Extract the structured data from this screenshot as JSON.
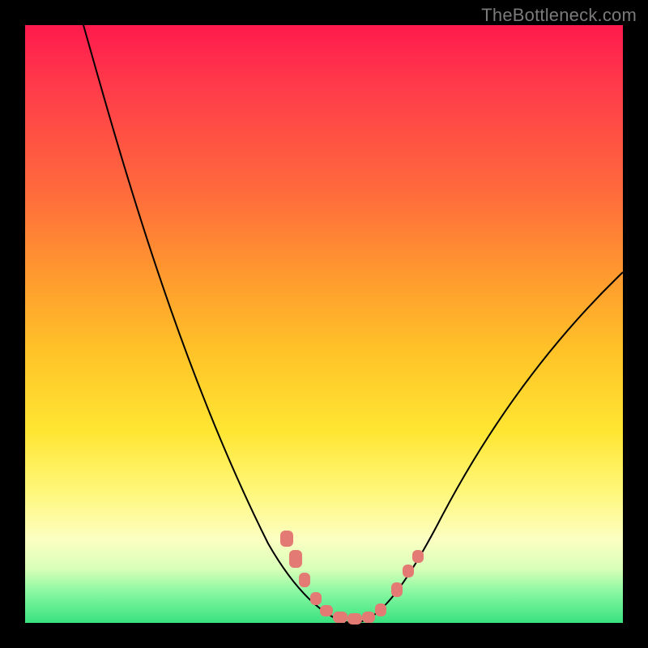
{
  "watermark": "TheBottleneck.com",
  "chart_data": {
    "type": "line",
    "title": "",
    "xlabel": "",
    "ylabel": "",
    "xlim": [
      0,
      100
    ],
    "ylim": [
      0,
      100
    ],
    "series": [
      {
        "name": "bottleneck-curve",
        "x": [
          10,
          15,
          20,
          25,
          30,
          35,
          40,
          45,
          50,
          53,
          55,
          58,
          60,
          65,
          70,
          75,
          80,
          85,
          90,
          95,
          100
        ],
        "y": [
          100,
          86,
          72,
          59,
          46,
          34,
          23,
          13,
          5,
          1,
          0,
          1,
          3,
          9,
          17,
          25,
          33,
          41,
          48,
          54,
          59
        ]
      }
    ],
    "markers": {
      "name": "highlight-beads",
      "shape": "rounded-square",
      "color": "#e37b74",
      "points": [
        {
          "x": 44,
          "y": 14
        },
        {
          "x": 45.5,
          "y": 11
        },
        {
          "x": 48,
          "y": 6
        },
        {
          "x": 50,
          "y": 3
        },
        {
          "x": 52,
          "y": 1
        },
        {
          "x": 54,
          "y": 0
        },
        {
          "x": 56,
          "y": 0
        },
        {
          "x": 58,
          "y": 1
        },
        {
          "x": 60,
          "y": 3
        },
        {
          "x": 62,
          "y": 6
        },
        {
          "x": 64,
          "y": 9
        },
        {
          "x": 66,
          "y": 12
        }
      ]
    }
  }
}
